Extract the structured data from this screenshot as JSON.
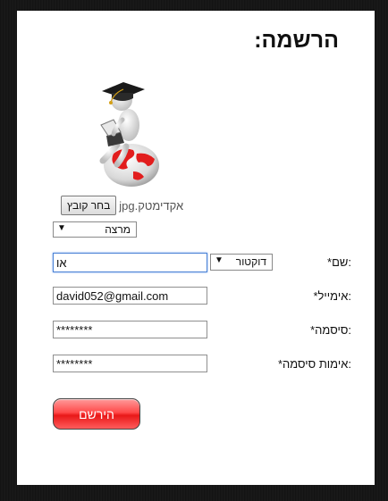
{
  "form": {
    "title": "הרשמה:",
    "file": {
      "button_label": "בחר קובץ",
      "file_name": "אקדימטק.jpg"
    },
    "role_select": {
      "value": "מרצה"
    },
    "fields": {
      "name": {
        "label": ":שם*",
        "prefix_value": "דוקטור",
        "value": "או"
      },
      "email": {
        "label": ":אימייל*",
        "value": "david052@gmail.com"
      },
      "password": {
        "label": ":סיסמה*",
        "value": "********"
      },
      "confirm_password": {
        "label": ":אימות סיסמה*",
        "value": "********"
      }
    },
    "submit_label": "הירשם"
  }
}
